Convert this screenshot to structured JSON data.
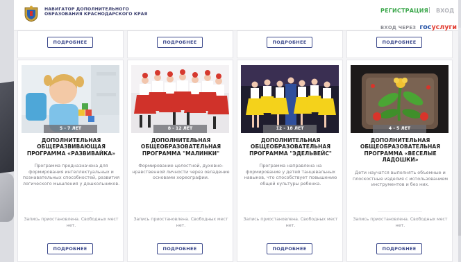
{
  "header": {
    "title": "НАВИГАТОР ДОПОЛНИТЕЛЬНОГО ОБРАЗОВАНИЯ КРАСНОДАРСКОГО КРАЯ",
    "register_label": "РЕГИСТРАЦИЯ",
    "separator": "|",
    "login_label": "ВХОД",
    "gos_prefix": "ВХОД ЧЕРЕЗ",
    "gos_logo_a": "гос",
    "gos_logo_b": "услуги"
  },
  "more_label": "ПОДРОБНЕЕ",
  "programs": [
    {
      "age": "5 - 7 ЛЕТ",
      "title": "ДОПОЛНИТЕЛЬНАЯ ОБЩЕРАЗВИВАЮЩАЯ ПРОГРАММА «РАЗВИВАЙКА»",
      "description": "Программа предназначена для формирования интеллектуальных и познавательных способностей, развития логического мышления у дошкольников.",
      "status": "Запись приостановлена. Свободных мест нет."
    },
    {
      "age": "8 - 12 ЛЕТ",
      "title": "ДОПОЛНИТЕЛЬНАЯ ОБЩЕОБРАЗОВАТЕЛЬНАЯ ПРОГРАММА \"МАЛИНКИ\"",
      "description": "Формирование целостной, духовно-нравственной личности через овладение основами хореографии.",
      "status": "Запись приостановлена. Свободных мест нет."
    },
    {
      "age": "12 - 18 ЛЕТ",
      "title": "ДОПОЛНИТЕЛЬНАЯ ОБЩЕОБРАЗОВАТЕЛЬНАЯ ПРОГРАММА \"ЭДЕЛЬВЕЙС\"",
      "description": "Программа направлена на формирование у детей танцевальных навыков, что способствует повышению общей культуры ребенка.",
      "status": "Запись приостановлена. Свободных мест нет."
    },
    {
      "age": "4 - 5 ЛЕТ",
      "title": "ДОПОЛНИТЕЛЬНАЯ ОБЩЕОБРАЗОВАТЕЛЬНАЯ ПРОГРАММА «ВЕСЕЛЫЕ ЛАДОШКИ»",
      "description": "Дети научатся выполнять объемные и плоскостные изделия с использованием инструментов и без них.",
      "status": "Запись приостановлена. Свободных мест нет."
    }
  ],
  "colors": {
    "accent": "#3d4a8c",
    "register": "#3aa64a",
    "gos_blue": "#1f4ea3",
    "gos_red": "#e23d32"
  },
  "icons": {
    "logo": "krasnodar-coat-of-arms-icon"
  }
}
